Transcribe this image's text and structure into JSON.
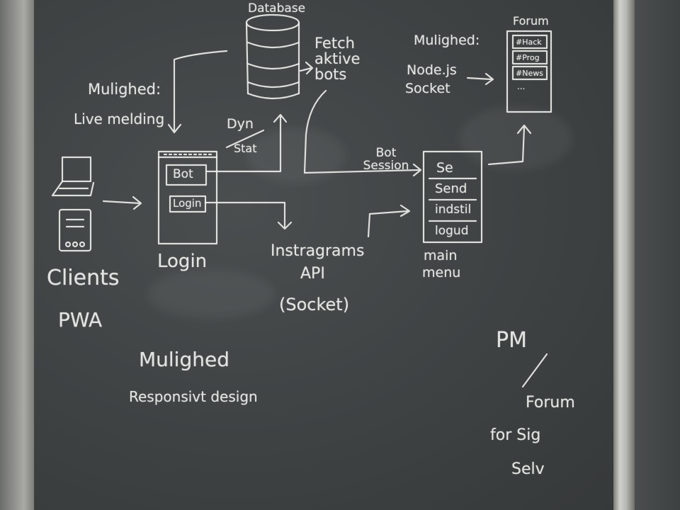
{
  "diagram": {
    "database": {
      "title": "Database"
    },
    "fetch_note": "Fetch aktive bots",
    "left_option": {
      "heading": "Mulighed:",
      "text": "Live melding"
    },
    "dyn_static": {
      "top": "Dyn",
      "bottom": "Stat"
    },
    "login_screen": {
      "bot_button": "Bot",
      "login_button": "Login",
      "caption": "Login"
    },
    "bot_session": "Bot Session",
    "instagram": {
      "line1": "Instragrams",
      "line2": "API",
      "line3": "(Socket)"
    },
    "main_menu": {
      "items": [
        "Se",
        "Send",
        "indstil",
        "logud"
      ],
      "caption_line1": "main",
      "caption_line2": "menu"
    },
    "forum": {
      "title": "Forum",
      "tags": [
        "#Hack",
        "#Prog",
        "#News"
      ],
      "dots": "..."
    },
    "right_option": {
      "heading": "Mulighed:",
      "line1": "Node.js",
      "line2": "Socket"
    },
    "clients": {
      "line1": "Clients",
      "line2": "PWA"
    },
    "responsive": {
      "heading": "Mulighed",
      "text": "Responsivt design"
    },
    "pm_forum": {
      "line1": "PM",
      "line2": "Forum",
      "line3": "for Sig",
      "line4": "Selv"
    }
  }
}
